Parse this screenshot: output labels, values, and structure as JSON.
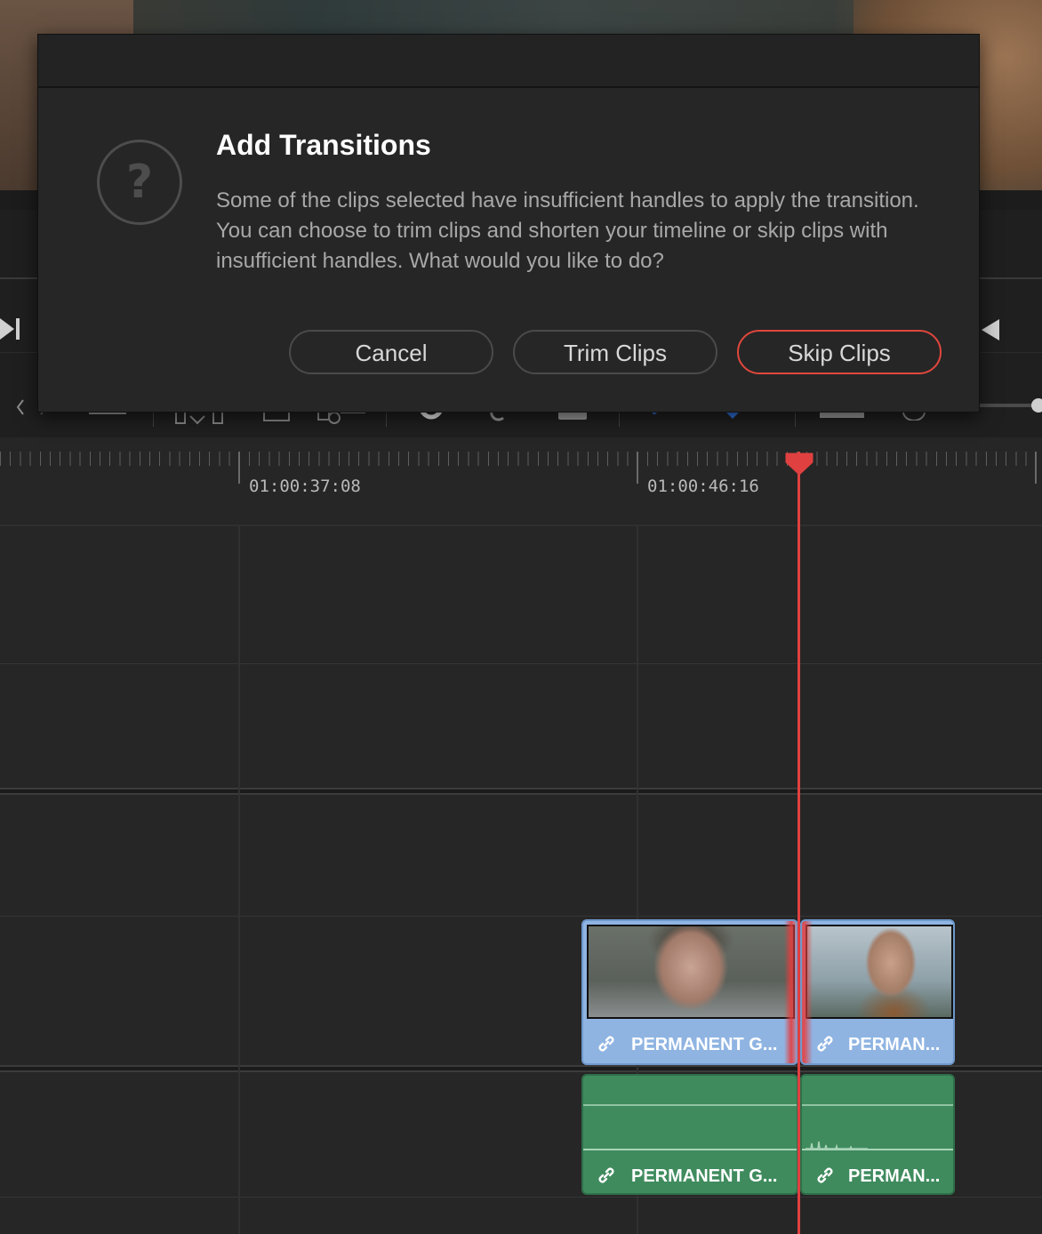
{
  "dialog": {
    "title": "Add Transitions",
    "message": "Some of the clips selected have insufficient handles to apply the transition. You can choose to trim clips and shorten your timeline or skip clips with insufficient handles. What would you like to do?",
    "help_glyph": "?",
    "buttons": {
      "cancel": "Cancel",
      "trim": "Trim Clips",
      "skip": "Skip Clips"
    },
    "accent_color": "#e0473c"
  },
  "timeline": {
    "timecodes": [
      "01:00:37:08",
      "01:00:46:16"
    ],
    "playhead_color": "#e04040",
    "video_clips": [
      {
        "label": "PERMANENT G...",
        "icon": "link-icon"
      },
      {
        "label": "PERMAN...",
        "icon": "link-icon"
      }
    ],
    "audio_clips": [
      {
        "label": "PERMANENT G...",
        "icon": "link-icon"
      },
      {
        "label": "PERMAN...",
        "icon": "link-icon"
      }
    ],
    "video_clip_color": "#8fb4e2",
    "audio_clip_color": "#3f8b5e"
  },
  "icons": {
    "link": "🔗",
    "next_clip": "⏭",
    "prev": "◀"
  }
}
